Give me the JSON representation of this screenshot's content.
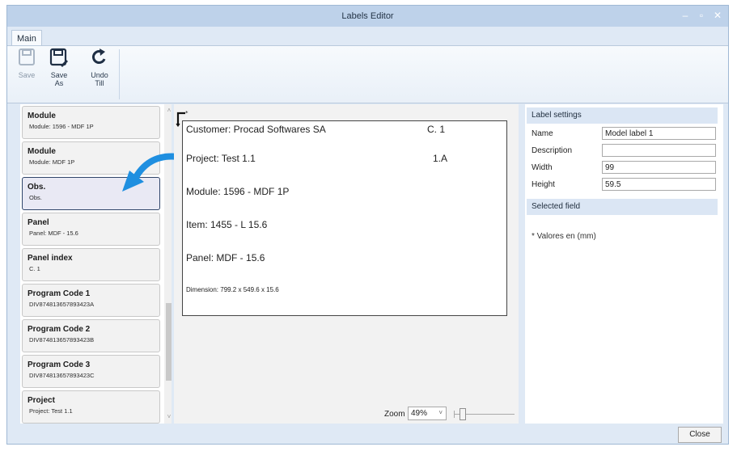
{
  "window": {
    "title": "Labels Editor",
    "controls": [
      "–",
      "▫",
      "✕"
    ]
  },
  "ribbon": {
    "tab_main": "Main",
    "buttons": [
      {
        "label_line1": "Save",
        "label_line2": "",
        "icon": "save-icon",
        "enabled": false
      },
      {
        "label_line1": "Save",
        "label_line2": "As",
        "icon": "save-as-icon",
        "enabled": true
      },
      {
        "label_line1": "Undo",
        "label_line2": "Till",
        "icon": "undo-icon",
        "enabled": true
      }
    ]
  },
  "fields": [
    {
      "title": "Module",
      "subtitle": "Module: 1596 - MDF 1P"
    },
    {
      "title": "Module",
      "subtitle": "Module: MDF 1P"
    },
    {
      "title": "Obs.",
      "subtitle": "Obs.",
      "selected": true
    },
    {
      "title": "Panel",
      "subtitle": "Panel: MDF - 15.6"
    },
    {
      "title": "Panel index",
      "subtitle": "C. 1"
    },
    {
      "title": "Program Code 1",
      "subtitle": "DIV874813657893423A"
    },
    {
      "title": "Program Code 2",
      "subtitle": "DIV874813657893423B"
    },
    {
      "title": "Program Code 3",
      "subtitle": "DIV874813657893423C"
    },
    {
      "title": "Project",
      "subtitle": "Project: Test 1.1"
    }
  ],
  "label_preview": {
    "anchor_symbol": "*",
    "customer": "Customer: Procad Softwares SA",
    "panel_index": "C. 1",
    "project": "Project: Test 1.1",
    "project_code": "1.A",
    "module": "Module: 1596 - MDF 1P",
    "item": "Item: 1455 - L 15.6",
    "panel": "Panel: MDF - 15.6",
    "dimension": "Dimension: 799.2 x 549.6 x 15.6"
  },
  "zoom": {
    "label": "Zoom",
    "value": "49%",
    "dropdown_arrow": "˅",
    "slider_fraction": 0.15
  },
  "settings": {
    "header": "Label settings",
    "name_label": "Name",
    "name_value": "Model label 1",
    "description_label": "Description",
    "description_value": "",
    "width_label": "Width",
    "width_value": "99",
    "height_label": "Height",
    "height_value": "59.5",
    "selected_field_header": "Selected field",
    "units_note": "* Valores en (mm)"
  },
  "footer": {
    "close_label": "Close"
  },
  "colors": {
    "titlebar": "#bed2ea",
    "accent_arrow": "#1f8fe0",
    "selected_border": "#30466a"
  }
}
